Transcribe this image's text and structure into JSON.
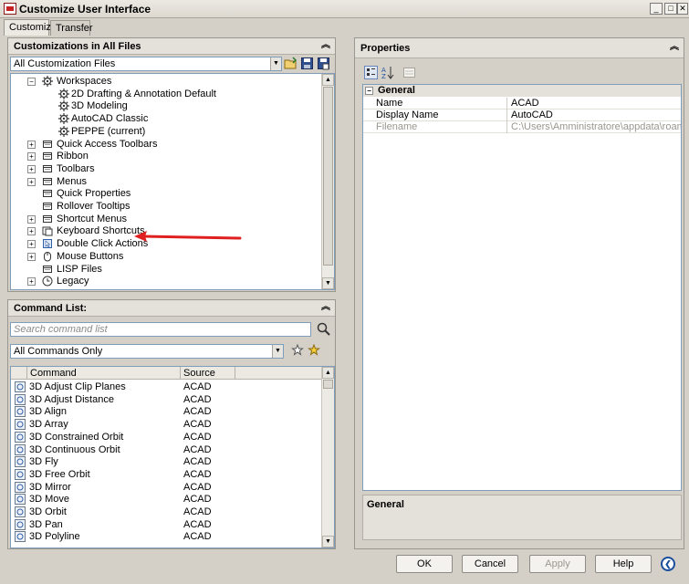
{
  "window": {
    "title": "Customize User Interface"
  },
  "tabs": [
    {
      "label": "Customize"
    },
    {
      "label": "Transfer"
    }
  ],
  "customizations": {
    "header": "Customizations in All Files",
    "filter_value": "All Customization Files",
    "tree": [
      {
        "label": "Workspaces",
        "expander": "−",
        "icon": "workspaces-icon"
      },
      {
        "label": "2D Drafting & Annotation Default",
        "icon": "workspace-gear-icon"
      },
      {
        "label": "3D Modeling",
        "icon": "workspace-gear-icon"
      },
      {
        "label": "AutoCAD Classic",
        "icon": "workspace-gear-icon"
      },
      {
        "label": "PEPPE (current)",
        "icon": "workspace-gear-icon"
      },
      {
        "label": "Quick Access Toolbars",
        "expander": "+",
        "icon": "toolbar-icon"
      },
      {
        "label": "Ribbon",
        "expander": "+",
        "icon": "ribbon-icon"
      },
      {
        "label": "Toolbars",
        "expander": "+",
        "icon": "toolbars-icon"
      },
      {
        "label": "Menus",
        "expander": "+",
        "icon": "menus-icon"
      },
      {
        "label": "Quick Properties",
        "icon": "quick-properties-icon"
      },
      {
        "label": "Rollover Tooltips",
        "icon": "rollover-tooltips-icon"
      },
      {
        "label": "Shortcut Menus",
        "expander": "+",
        "icon": "shortcut-menus-icon"
      },
      {
        "label": "Keyboard Shortcuts",
        "expander": "+",
        "icon": "keyboard-shortcuts-icon"
      },
      {
        "label": "Double Click Actions",
        "expander": "+",
        "icon": "double-click-icon"
      },
      {
        "label": "Mouse Buttons",
        "expander": "+",
        "icon": "mouse-icon"
      },
      {
        "label": "LISP Files",
        "icon": "lisp-files-icon"
      },
      {
        "label": "Legacy",
        "expander": "+",
        "icon": "legacy-icon"
      }
    ]
  },
  "command_list": {
    "header": "Command List:",
    "search_placeholder": "Search command list",
    "filter_value": "All Commands Only",
    "col_command": "Command",
    "col_source": "Source",
    "rows": [
      {
        "command": "3D Adjust Clip Planes",
        "source": "ACAD"
      },
      {
        "command": "3D Adjust Distance",
        "source": "ACAD"
      },
      {
        "command": "3D Align",
        "source": "ACAD"
      },
      {
        "command": "3D Array",
        "source": "ACAD"
      },
      {
        "command": "3D Constrained Orbit",
        "source": "ACAD"
      },
      {
        "command": "3D Continuous Orbit",
        "source": "ACAD"
      },
      {
        "command": "3D Fly",
        "source": "ACAD"
      },
      {
        "command": "3D Free Orbit",
        "source": "ACAD"
      },
      {
        "command": "3D Mirror",
        "source": "ACAD"
      },
      {
        "command": "3D Move",
        "source": "ACAD"
      },
      {
        "command": "3D Orbit",
        "source": "ACAD"
      },
      {
        "command": "3D Pan",
        "source": "ACAD"
      },
      {
        "command": "3D Polyline",
        "source": "ACAD"
      }
    ]
  },
  "properties": {
    "header": "Properties",
    "category": "General",
    "rows": [
      {
        "name": "Name",
        "value": "ACAD",
        "disabled": false
      },
      {
        "name": "Display Name",
        "value": "AutoCAD",
        "disabled": false
      },
      {
        "name": "Filename",
        "value": "C:\\Users\\Amministratore\\appdata\\roaming\\au",
        "disabled": true
      }
    ],
    "description_title": "General"
  },
  "buttons": {
    "ok": "OK",
    "cancel": "Cancel",
    "apply": "Apply",
    "help": "Help"
  },
  "colors": {
    "annotation_arrow": "#e02020",
    "selection_blue": "#1b4f9c"
  }
}
